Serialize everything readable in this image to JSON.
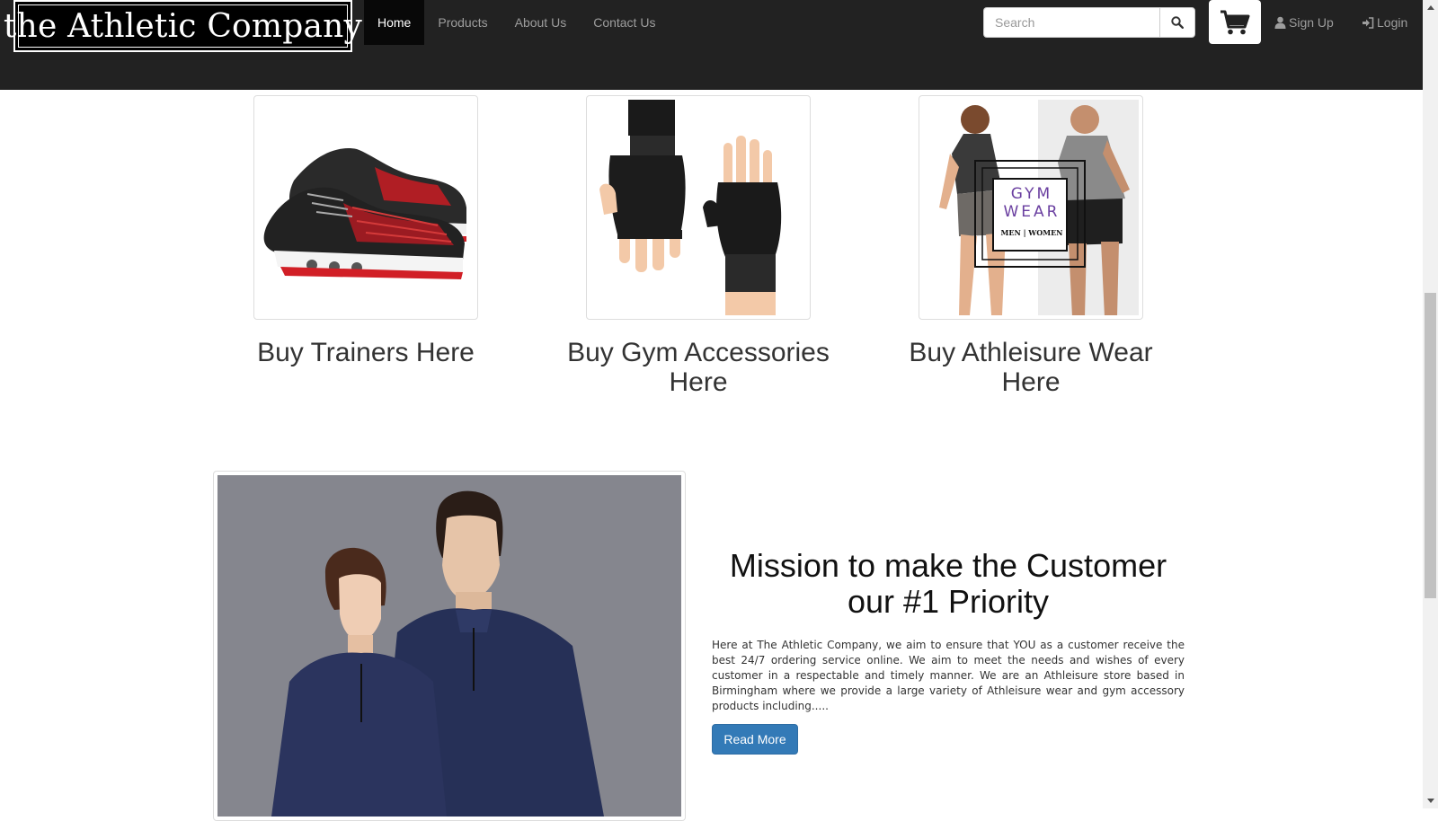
{
  "brand": {
    "logo_text": "the Athletic Company"
  },
  "nav": {
    "items": [
      {
        "label": "Home",
        "active": true
      },
      {
        "label": "Products",
        "active": false
      },
      {
        "label": "About Us",
        "active": false
      },
      {
        "label": "Contact Us",
        "active": false
      }
    ],
    "search_placeholder": "Search",
    "sign_up": "Sign Up",
    "login": "Login"
  },
  "products": [
    {
      "title": "Buy Trainers Here"
    },
    {
      "title": "Buy Gym Accessories Here"
    },
    {
      "title": "Buy Athleisure Wear Here"
    }
  ],
  "gym_wear_sign": {
    "line1": "GYM",
    "line2": "WEAR",
    "line3": "MEN | WOMEN"
  },
  "mission": {
    "title": "Mission to make the Customer our #1 Priority",
    "text": "Here at The Athletic Company, we aim to ensure that YOU as a customer receive the best 24/7 ordering service online. We aim to meet the needs and wishes of every customer in a respectable and timely manner. We are an Athleisure store based in Birmingham where we provide a large variety of Athleisure wear and gym accessory products including.....",
    "button": "Read More"
  },
  "colors": {
    "navbar": "#222222",
    "primary": "#337ab7",
    "gym_wear_purple": "#6a3fa0"
  }
}
